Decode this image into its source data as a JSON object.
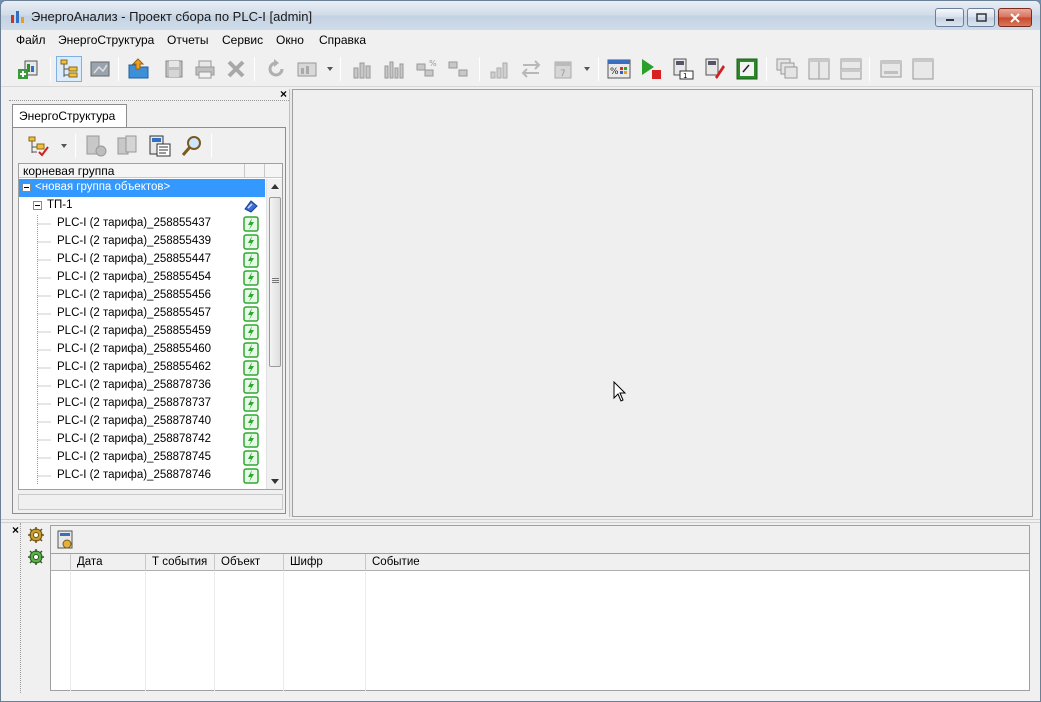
{
  "window": {
    "title": "ЭнергоАнализ - Проект сбора по PLC-I [admin]"
  },
  "menu": [
    "Файл",
    "ЭнергоСтруктура",
    "Отчеты",
    "Сервис",
    "Окно",
    "Справка"
  ],
  "left_panel": {
    "tab_label": "ЭнергоСтруктура",
    "tree_header": "корневая группа",
    "root_item": "<новая группа объектов>",
    "tp_node": "ТП-1",
    "devices": [
      "PLC-I (2 тарифа)_258855437",
      "PLC-I (2 тарифа)_258855439",
      "PLC-I (2 тарифа)_258855447",
      "PLC-I (2 тарифа)_258855454",
      "PLC-I (2 тарифа)_258855456",
      "PLC-I (2 тарифа)_258855457",
      "PLC-I (2 тарифа)_258855459",
      "PLC-I (2 тарифа)_258855460",
      "PLC-I (2 тарифа)_258855462",
      "PLC-I (2 тарифа)_258878736",
      "PLC-I (2 тарифа)_258878737",
      "PLC-I (2 тарифа)_258878740",
      "PLC-I (2 тарифа)_258878742",
      "PLC-I (2 тарифа)_258878745",
      "PLC-I (2 тарифа)_258878746"
    ]
  },
  "events_panel": {
    "columns": [
      "Дата",
      "Т события",
      "Объект",
      "Шифр",
      "Событие"
    ]
  },
  "colors": {
    "selection": "#3399ff",
    "device_icon": "#2fa82f"
  }
}
